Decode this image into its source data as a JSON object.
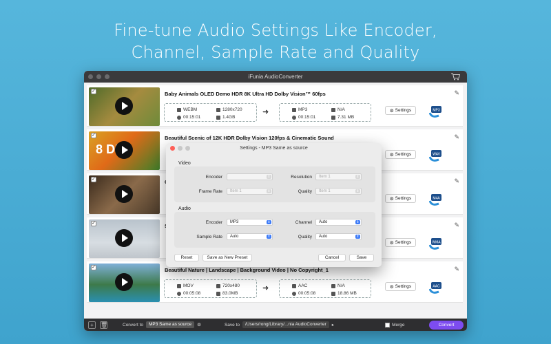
{
  "headline": {
    "line1": "Fine-tune Audio Settings Like Encoder,",
    "line2": "Channel, Sample Rate and Quality"
  },
  "window": {
    "title": "iFunia AudioConverter"
  },
  "files": [
    {
      "title": "Baby Animals OLED Demo HDR 8K Ultra HD Dolby Vision™ 60fps",
      "source": {
        "format": "WEBM",
        "resolution": "1280x720",
        "duration": "00:15:01",
        "size": "1.4GB"
      },
      "output": {
        "format": "MP3",
        "resolution": "N/A",
        "duration": "00:15:01",
        "size": "7.31 MB"
      },
      "settings_label": "Settings",
      "format_icon_label": "MP3",
      "overlay_text": ""
    },
    {
      "title": "Beautiful Scenic of 12K HDR Dolby Vision 120fps & Cinematic Sound",
      "source": {
        "format": "",
        "resolution": "",
        "duration": "",
        "size": ""
      },
      "output": {
        "format": "",
        "resolution": "",
        "duration": "",
        "size": ""
      },
      "settings_label": "Settings",
      "format_icon_label": "WAV",
      "overlay_text": "8 DR"
    },
    {
      "title": "C",
      "source": {
        "format": "",
        "resolution": "",
        "duration": "",
        "size": ""
      },
      "output": {
        "format": "",
        "resolution": "",
        "duration": "",
        "size": ""
      },
      "settings_label": "Settings",
      "format_icon_label": "M4A",
      "overlay_text": ""
    },
    {
      "title": "S",
      "source": {
        "format": "",
        "resolution": "",
        "duration": "",
        "size": ""
      },
      "output": {
        "format": "",
        "resolution": "",
        "duration": "",
        "size": ""
      },
      "settings_label": "Settings",
      "format_icon_label": "WMA",
      "overlay_text": ""
    },
    {
      "title": "Beautiful Nature | Landscape | Background Video | No Copyright_1",
      "source": {
        "format": "MOV",
        "resolution": "720x480",
        "duration": "00:05:08",
        "size": "83.0MB"
      },
      "output": {
        "format": "AAC",
        "resolution": "N/A",
        "duration": "00:05:08",
        "size": "18.86 MB"
      },
      "settings_label": "Settings",
      "format_icon_label": "AAC",
      "overlay_text": ""
    }
  ],
  "bottombar": {
    "convert_to_label": "Convert to",
    "convert_to_value": "MP3 Same as source",
    "save_to_label": "Save to",
    "save_to_value": "/Users/rong/Library/...nia AudioConverter",
    "merge_label": "Merge",
    "convert_button": "Convert"
  },
  "dialog": {
    "title": "Settings - MP3 Same as source",
    "video_label": "Video",
    "video": {
      "encoder_label": "Encoder",
      "encoder_value": "",
      "resolution_label": "Resolution",
      "resolution_value": "Item 1",
      "frame_rate_label": "Frame Rate",
      "frame_rate_value": "Item 1",
      "quality_label": "Quality",
      "quality_value": "Item 1"
    },
    "audio_label": "Audio",
    "audio": {
      "encoder_label": "Encoder",
      "encoder_value": "MP3",
      "channel_label": "Channel",
      "channel_value": "Auto",
      "sample_rate_label": "Sample Rate",
      "sample_rate_value": "Auto",
      "quality_label": "Quality",
      "quality_value": "Auto"
    },
    "buttons": {
      "reset": "Reset",
      "save_preset": "Save as New Preset",
      "cancel": "Cancel",
      "save": "Save"
    }
  },
  "colors": {
    "background": "#4aaed6",
    "accent": "#7d4cf0",
    "select_accent": "#3d7bf7",
    "close_light": "#fe5f57"
  },
  "icons": {
    "cart": "cart-icon",
    "edit": "pencil-icon",
    "settings": "gear-icon",
    "play": "play-icon",
    "arrow": "arrow-right-icon",
    "add": "plus-icon",
    "trash": "trash-icon",
    "folder": "folder-icon"
  }
}
